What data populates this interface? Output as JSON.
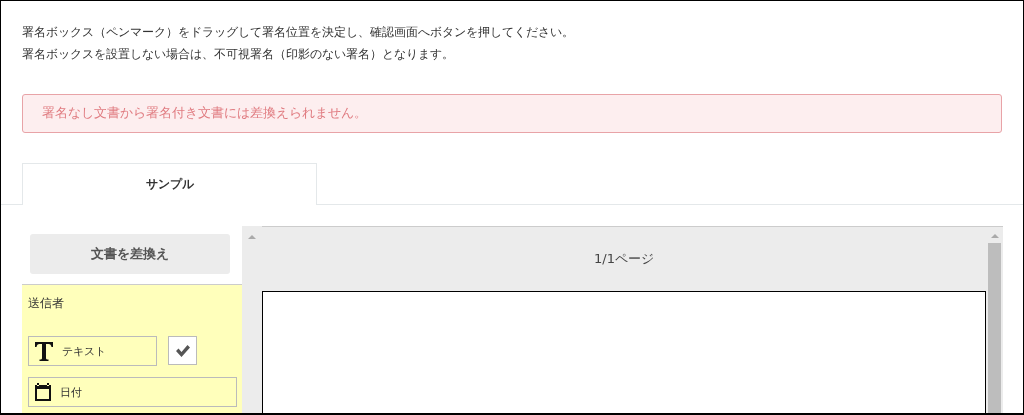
{
  "instructions": [
    "署名ボックス（ペンマーク）をドラッグして署名位置を決定し、確認画面へボタンを押してください。",
    "署名ボックスを設置しない場合は、不可視署名（印影のない署名）となります。"
  ],
  "alert": "署名なし文書から署名付き文書には差換えられません。",
  "tabs": [
    {
      "label": "サンプル",
      "selected": true
    }
  ],
  "replace_button": "文書を差換え",
  "signer_panel": {
    "title": "送信者",
    "fields": [
      {
        "kind": "text",
        "label": "テキスト",
        "checked": true
      },
      {
        "kind": "date",
        "label": "日付"
      }
    ]
  },
  "viewer": {
    "page_label": "1/1ページ"
  }
}
